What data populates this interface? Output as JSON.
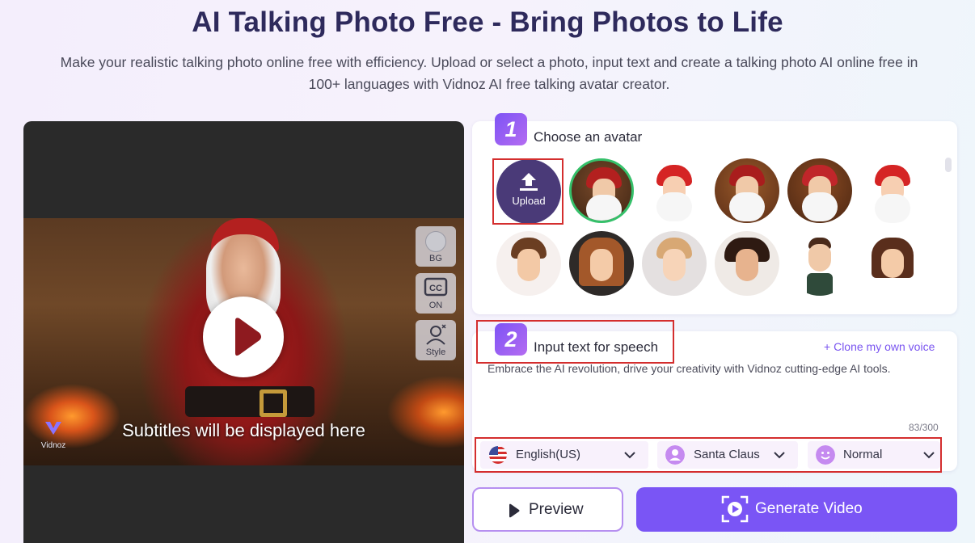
{
  "header": {
    "title": "AI Talking Photo Free - Bring Photos to Life",
    "description": "Make your realistic talking photo online free with efficiency. Upload or select a photo, input text and create a talking photo AI online free in 100+ languages with Vidnoz AI free talking avatar creator."
  },
  "video": {
    "subtitle": "Subtitles will be displayed here",
    "logo_text": "Vidnoz",
    "tools": [
      {
        "icon": "bg-circle-icon",
        "label": "BG"
      },
      {
        "icon": "cc-icon",
        "label": "ON"
      },
      {
        "icon": "style-icon",
        "label": "Style"
      }
    ]
  },
  "avatar_section": {
    "step": "1",
    "title": "Choose an avatar",
    "upload_label": "Upload",
    "avatars_row1": [
      "santa-photo-selected",
      "santa-cartoon",
      "santa-photo",
      "santa-photo",
      "santa-cartoon"
    ],
    "avatars_row2": [
      "man-cartoon",
      "woman-cartoon",
      "girl-cartoon",
      "boy-cartoon",
      "man-glasses-cartoon",
      "woman-cartoon"
    ]
  },
  "speech_section": {
    "step": "2",
    "title": "Input text for speech",
    "clone_link": "Clone my own voice",
    "text": "Embrace the AI revolution, drive your creativity with Vidnoz cutting-edge AI tools.",
    "char_count": "83/300",
    "language": "English(US)",
    "voice": "Santa Claus",
    "style": "Normal"
  },
  "actions": {
    "preview_label": "Preview",
    "generate_label": "Generate Video"
  },
  "colors": {
    "accent": "#7a55f5",
    "title": "#2e2a5c",
    "highlight": "#d42e2e"
  }
}
